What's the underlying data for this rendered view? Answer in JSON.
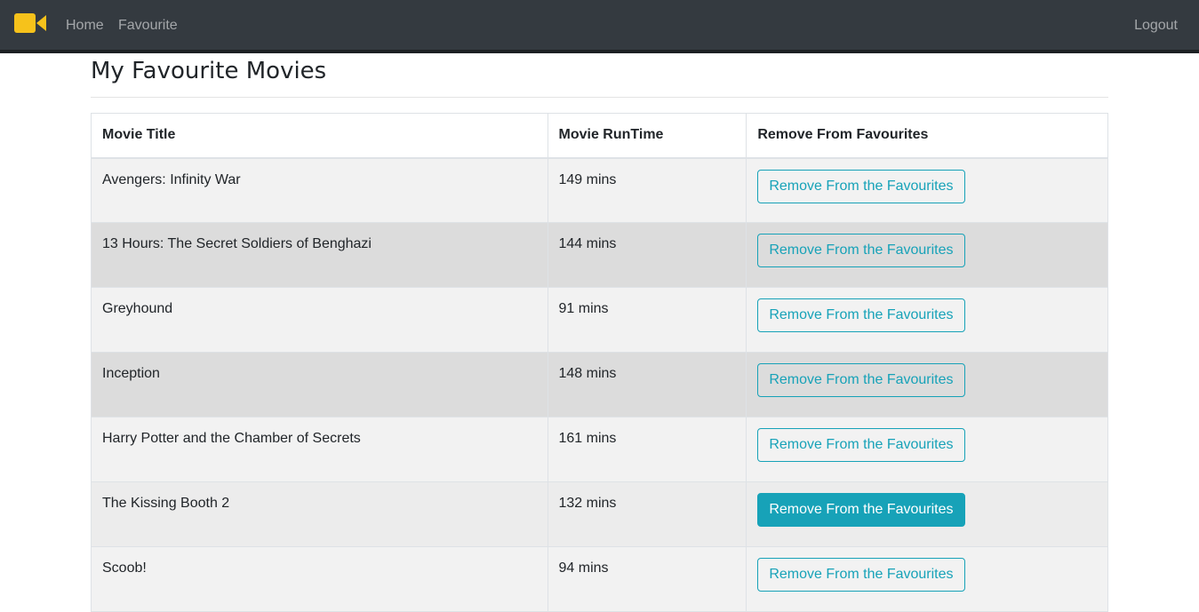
{
  "nav": {
    "home": "Home",
    "favourite": "Favourite",
    "logout": "Logout"
  },
  "page": {
    "title": "My Favourite Movies"
  },
  "table": {
    "headers": [
      "Movie Title",
      "Movie RunTime",
      "Remove From Favourites"
    ],
    "rows": [
      {
        "title": "Avengers: Infinity War",
        "runtime": "149 mins",
        "action": "Remove From the Favourites"
      },
      {
        "title": "13 Hours: The Secret Soldiers of Benghazi",
        "runtime": "144 mins",
        "action": "Remove From the Favourites"
      },
      {
        "title": "Greyhound",
        "runtime": "91 mins",
        "action": "Remove From the Favourites"
      },
      {
        "title": "Inception",
        "runtime": "148 mins",
        "action": "Remove From the Favourites"
      },
      {
        "title": "Harry Potter and the Chamber of Secrets",
        "runtime": "161 mins",
        "action": "Remove From the Favourites"
      },
      {
        "title": "The Kissing Booth 2",
        "runtime": "132 mins",
        "action": "Remove From the Favourites"
      },
      {
        "title": "Scoob!",
        "runtime": "94 mins",
        "action": "Remove From the Favourites"
      }
    ]
  },
  "colors": {
    "navbar": "#343a40",
    "brand_icon": "#f6c21b",
    "accent": "#17a2b8"
  },
  "icons": {
    "brand": "video-camera-icon"
  }
}
